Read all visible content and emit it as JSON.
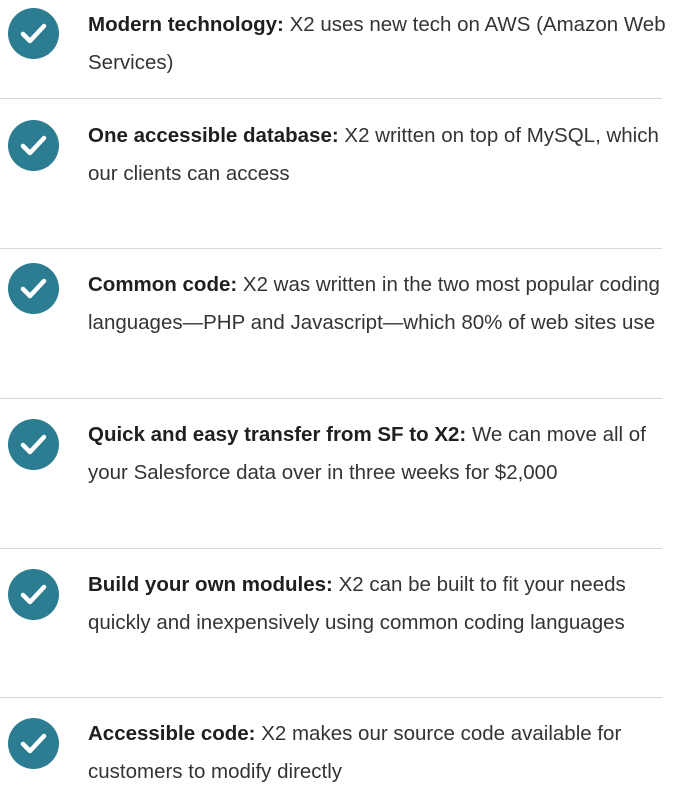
{
  "features": [
    {
      "title": "Modern technology:",
      "description": "X2 uses new tech on AWS (Amazon Web Services)",
      "icon": "check-circle-icon"
    },
    {
      "title": "One accessible database:",
      "description": "X2 written on top of MySQL, which our clients can access",
      "icon": "check-circle-icon"
    },
    {
      "title": "Common code:",
      "description": "X2 was written in the two most popular coding languages—PHP and Javascript—which 80% of web sites use",
      "icon": "check-circle-icon"
    },
    {
      "title": "Quick and easy transfer from SF to X2:",
      "description": "We can move all of your Salesforce data over in three weeks for $2,000",
      "icon": "check-circle-icon"
    },
    {
      "title": "Build your own modules:",
      "description": "X2 can be built to fit your needs quickly and inexpensively using common coding languages",
      "icon": "check-circle-icon"
    },
    {
      "title": "Accessible code:",
      "description": "X2 makes our source code available for customers to modify directly",
      "icon": "check-circle-icon"
    }
  ],
  "colors": {
    "accent": "#2c7d91",
    "divider": "#d8d8d8",
    "title_text": "#1f1f1f",
    "body_text": "#343434"
  }
}
